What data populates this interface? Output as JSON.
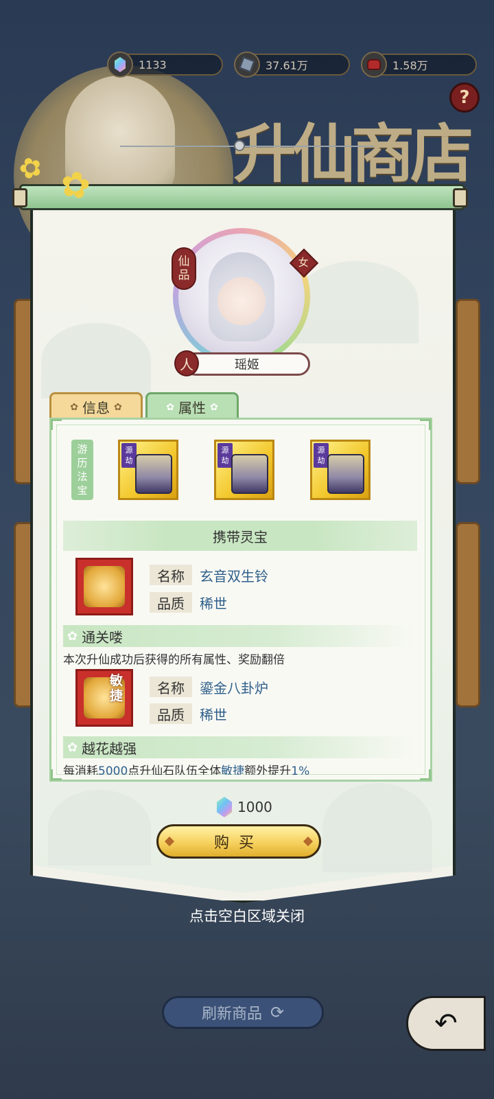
{
  "currency": [
    {
      "icon": "spirit-stone-icon",
      "value": "1133"
    },
    {
      "icon": "ore-icon",
      "value": "37.61万"
    },
    {
      "icon": "pouch-icon",
      "value": "1.58万"
    }
  ],
  "help_symbol": "?",
  "shop_title": "升仙商店",
  "character": {
    "grade_chars": [
      "仙",
      "品"
    ],
    "gender": "女",
    "race_char": "人",
    "name": "瑶姬"
  },
  "tabs": [
    {
      "label": "信息",
      "active": false
    },
    {
      "label": "属性",
      "active": true
    }
  ],
  "travel_treasure": {
    "label_chars": [
      "游",
      "历",
      "法",
      "宝"
    ],
    "items": [
      {
        "tag_chars": [
          "源",
          "劫"
        ],
        "icon": "cauldron-icon"
      },
      {
        "tag_chars": [
          "源",
          "劫"
        ],
        "icon": "cauldron-icon"
      },
      {
        "tag_chars": [
          "源",
          "劫"
        ],
        "icon": "cauldron-icon"
      }
    ]
  },
  "carried_section": "携带灵宝",
  "treasures": [
    {
      "name_key": "名称",
      "name": "玄音双生铃",
      "quality_key": "品质",
      "quality": "稀世",
      "icon": "bells-icon",
      "skill_title": "通关喽",
      "skill_desc": "本次升仙成功后获得的所有属性、奖励翻倍"
    },
    {
      "name_key": "名称",
      "name": "鎏金八卦炉",
      "quality_key": "品质",
      "quality": "稀世",
      "icon": "furnace-icon",
      "stat_tag_chars": [
        "敏",
        "捷"
      ],
      "skill_title": "越花越强",
      "skill_desc_parts": [
        "每消耗",
        "5000",
        "点升仙石队伍全体",
        "敏捷",
        "额外提升",
        "1%"
      ]
    }
  ],
  "price": {
    "icon": "spirit-stone-icon",
    "value": "1000"
  },
  "buy_label": "购买",
  "close_hint": "点击空白区域关闭",
  "refresh_label": "刷新商品",
  "back_symbol": "↶"
}
